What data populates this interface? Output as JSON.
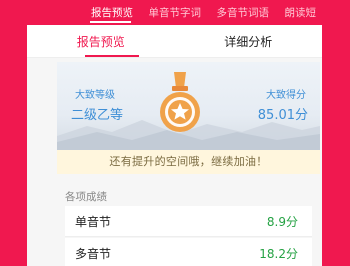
{
  "top_tabs": [
    {
      "label": "报告预览"
    },
    {
      "label": "单音节字词"
    },
    {
      "label": "多音节词语"
    },
    {
      "label": "朗读短"
    }
  ],
  "sub_tabs": [
    {
      "label": "报告预览"
    },
    {
      "label": "详细分析"
    }
  ],
  "summary": {
    "level_label": "大致等级",
    "level_value": "二级乙等",
    "score_label": "大致得分",
    "score_value": "85.01分"
  },
  "encourage_text": "还有提升的空间哦，继续加油！",
  "section_title": "各项成绩",
  "scores": [
    {
      "name": "单音节",
      "value": "8.9分"
    },
    {
      "name": "多音节",
      "value": "18.2分"
    }
  ],
  "colors": {
    "brand": "#f0184f",
    "accent_blue": "#3f8fd6",
    "score_green": "#25a244",
    "medal": "#f0a24a"
  }
}
